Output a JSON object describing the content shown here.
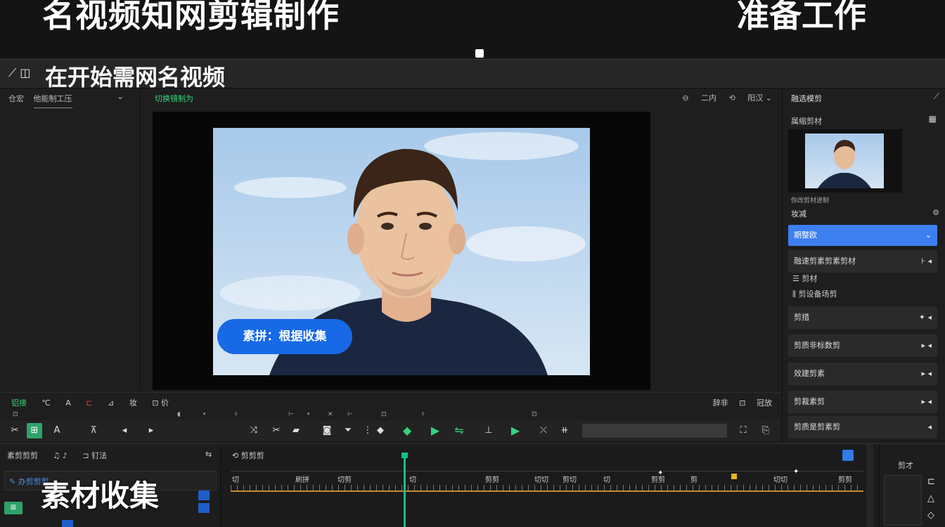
{
  "banner": {
    "title_left": "名视频知网剪辑制作",
    "title_right": "准备工作"
  },
  "titlebar": {
    "icons": "⟋ ◫",
    "title": "在开始需网名视频"
  },
  "left_panel": {
    "tabs": [
      "仓宏",
      "他能制工压"
    ],
    "chevron": "⌄"
  },
  "viewer": {
    "head_left": "切换镜制为",
    "head_right": [
      "⊖",
      "二内",
      "⟲",
      "阳汉 ⌄"
    ],
    "caption": "素拼：根据收集"
  },
  "right_panel": {
    "head": "融选模剪",
    "sub": "属缩剪材",
    "thumb_caption": "你改剪材进制",
    "section": "妆减",
    "selected": "期整欧",
    "rows": [
      {
        "label": "融速剪素剪素剪材",
        "arrows": "⊦ ◂"
      },
      {
        "label": "剪材",
        "plain": true,
        "icon": "☰"
      },
      {
        "label": "剪设备场剪",
        "plain": true,
        "icon": "⫼"
      },
      {
        "label": "剪措",
        "arrows": "✦ ◂"
      },
      {
        "label": "剪质非标数剪",
        "arrows": "▸ ◂"
      },
      {
        "label": "效建剪素",
        "arrows": "▸ ◂"
      },
      {
        "label": "剪裁素剪",
        "arrows": "▸ ◂"
      },
      {
        "label": "剪质是剪素剪",
        "arrows": "◂"
      }
    ]
  },
  "transport": {
    "top_left": "铝接",
    "top_left_icons": [
      "℃",
      "A",
      "⊏",
      "⊿"
    ],
    "top_mid": [
      "妆",
      "⊡ 价"
    ],
    "top_right": [
      "辞非",
      "⊡",
      "冠放"
    ],
    "ruler": [
      "⊡",
      "◖",
      "•",
      "⊦",
      "⊢",
      "•",
      "✕",
      "⊢",
      "⊡",
      "⊦",
      "⊡"
    ]
  },
  "timeline": {
    "left_head": [
      "素剪剪剪",
      "♫ ♪",
      "⊐ 钉法"
    ],
    "left_head_right": "⇆",
    "track_label": "✎ 办剪剪剪",
    "big_caption": "素材收集",
    "main_head": "⟲ 剪剪剪",
    "labels": [
      "切",
      "刷拼",
      "切剪",
      "切",
      "剪剪",
      "切切",
      "剪切",
      "切",
      "剪剪",
      "剪",
      "切切",
      "剪剪"
    ],
    "right_head": "剪才",
    "right_icons": [
      "⊏",
      "△",
      "◇"
    ]
  },
  "colors": {
    "accent_green": "#35d27d",
    "accent_blue": "#3d7ff0",
    "caption_blue": "#1769e6",
    "playhead": "#14c08e"
  }
}
